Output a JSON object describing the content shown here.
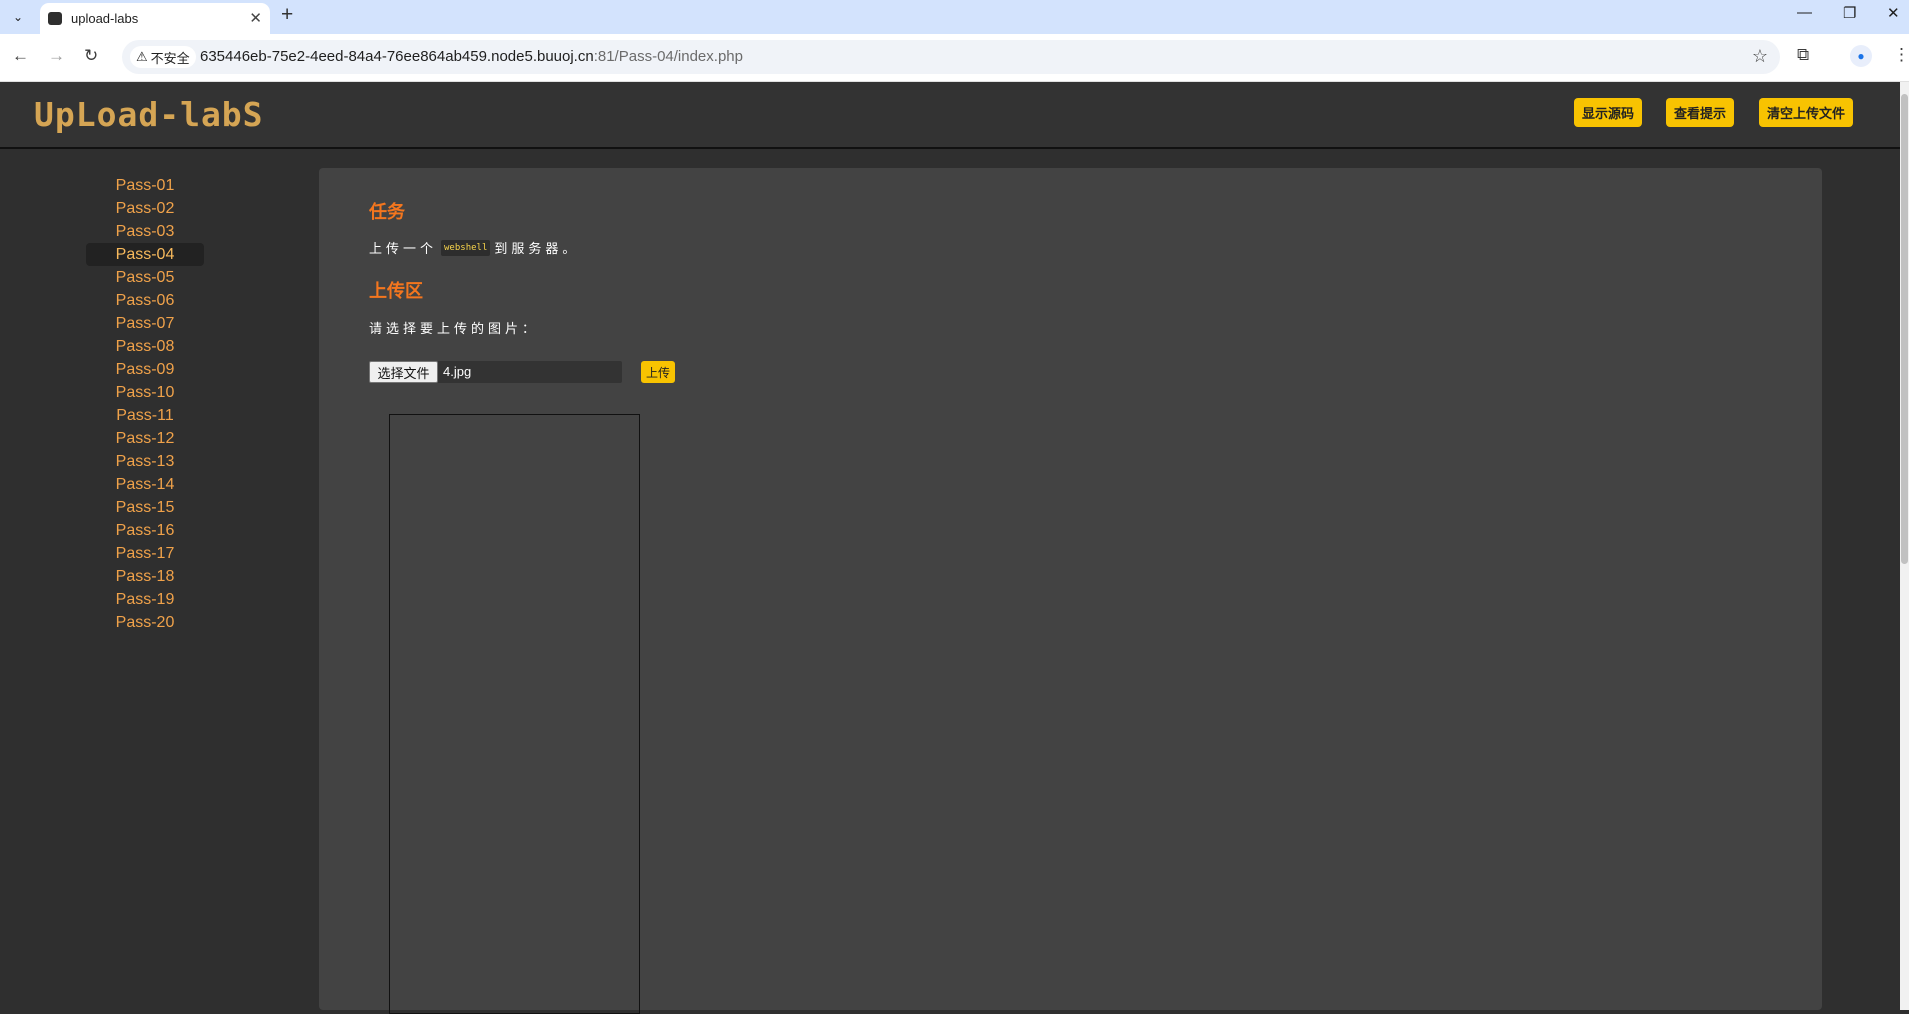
{
  "browser": {
    "tab_title": "upload-labs",
    "security_label": "不安全",
    "url_host": "635446eb-75e2-4eed-84a4-76ee864ab459.node5.buuoj.cn",
    "url_rest": ":81/Pass-04/index.php"
  },
  "header": {
    "logo_text": "UpLoad-labS",
    "buttons": [
      "显示源码",
      "查看提示",
      "清空上传文件"
    ]
  },
  "sidebar": {
    "active": "Pass-04",
    "items": [
      "Pass-01",
      "Pass-02",
      "Pass-03",
      "Pass-04",
      "Pass-05",
      "Pass-06",
      "Pass-07",
      "Pass-08",
      "Pass-09",
      "Pass-10",
      "Pass-11",
      "Pass-12",
      "Pass-13",
      "Pass-14",
      "Pass-15",
      "Pass-16",
      "Pass-17",
      "Pass-18",
      "Pass-19",
      "Pass-20"
    ]
  },
  "main": {
    "task_heading": "任务",
    "task_before": "上传一个",
    "task_code": "webshell",
    "task_after": "到服务器。",
    "upload_heading": "上传区",
    "upload_prompt": "请选择要上传的图片：",
    "choose_file_label": "选择文件",
    "file_name": "4.jpg",
    "upload_button": "上传"
  },
  "colors": {
    "accent_orange": "#f4761e",
    "menu_link": "#f0a24a",
    "button_yellow": "#f8c301",
    "logo": "#d5a554"
  }
}
